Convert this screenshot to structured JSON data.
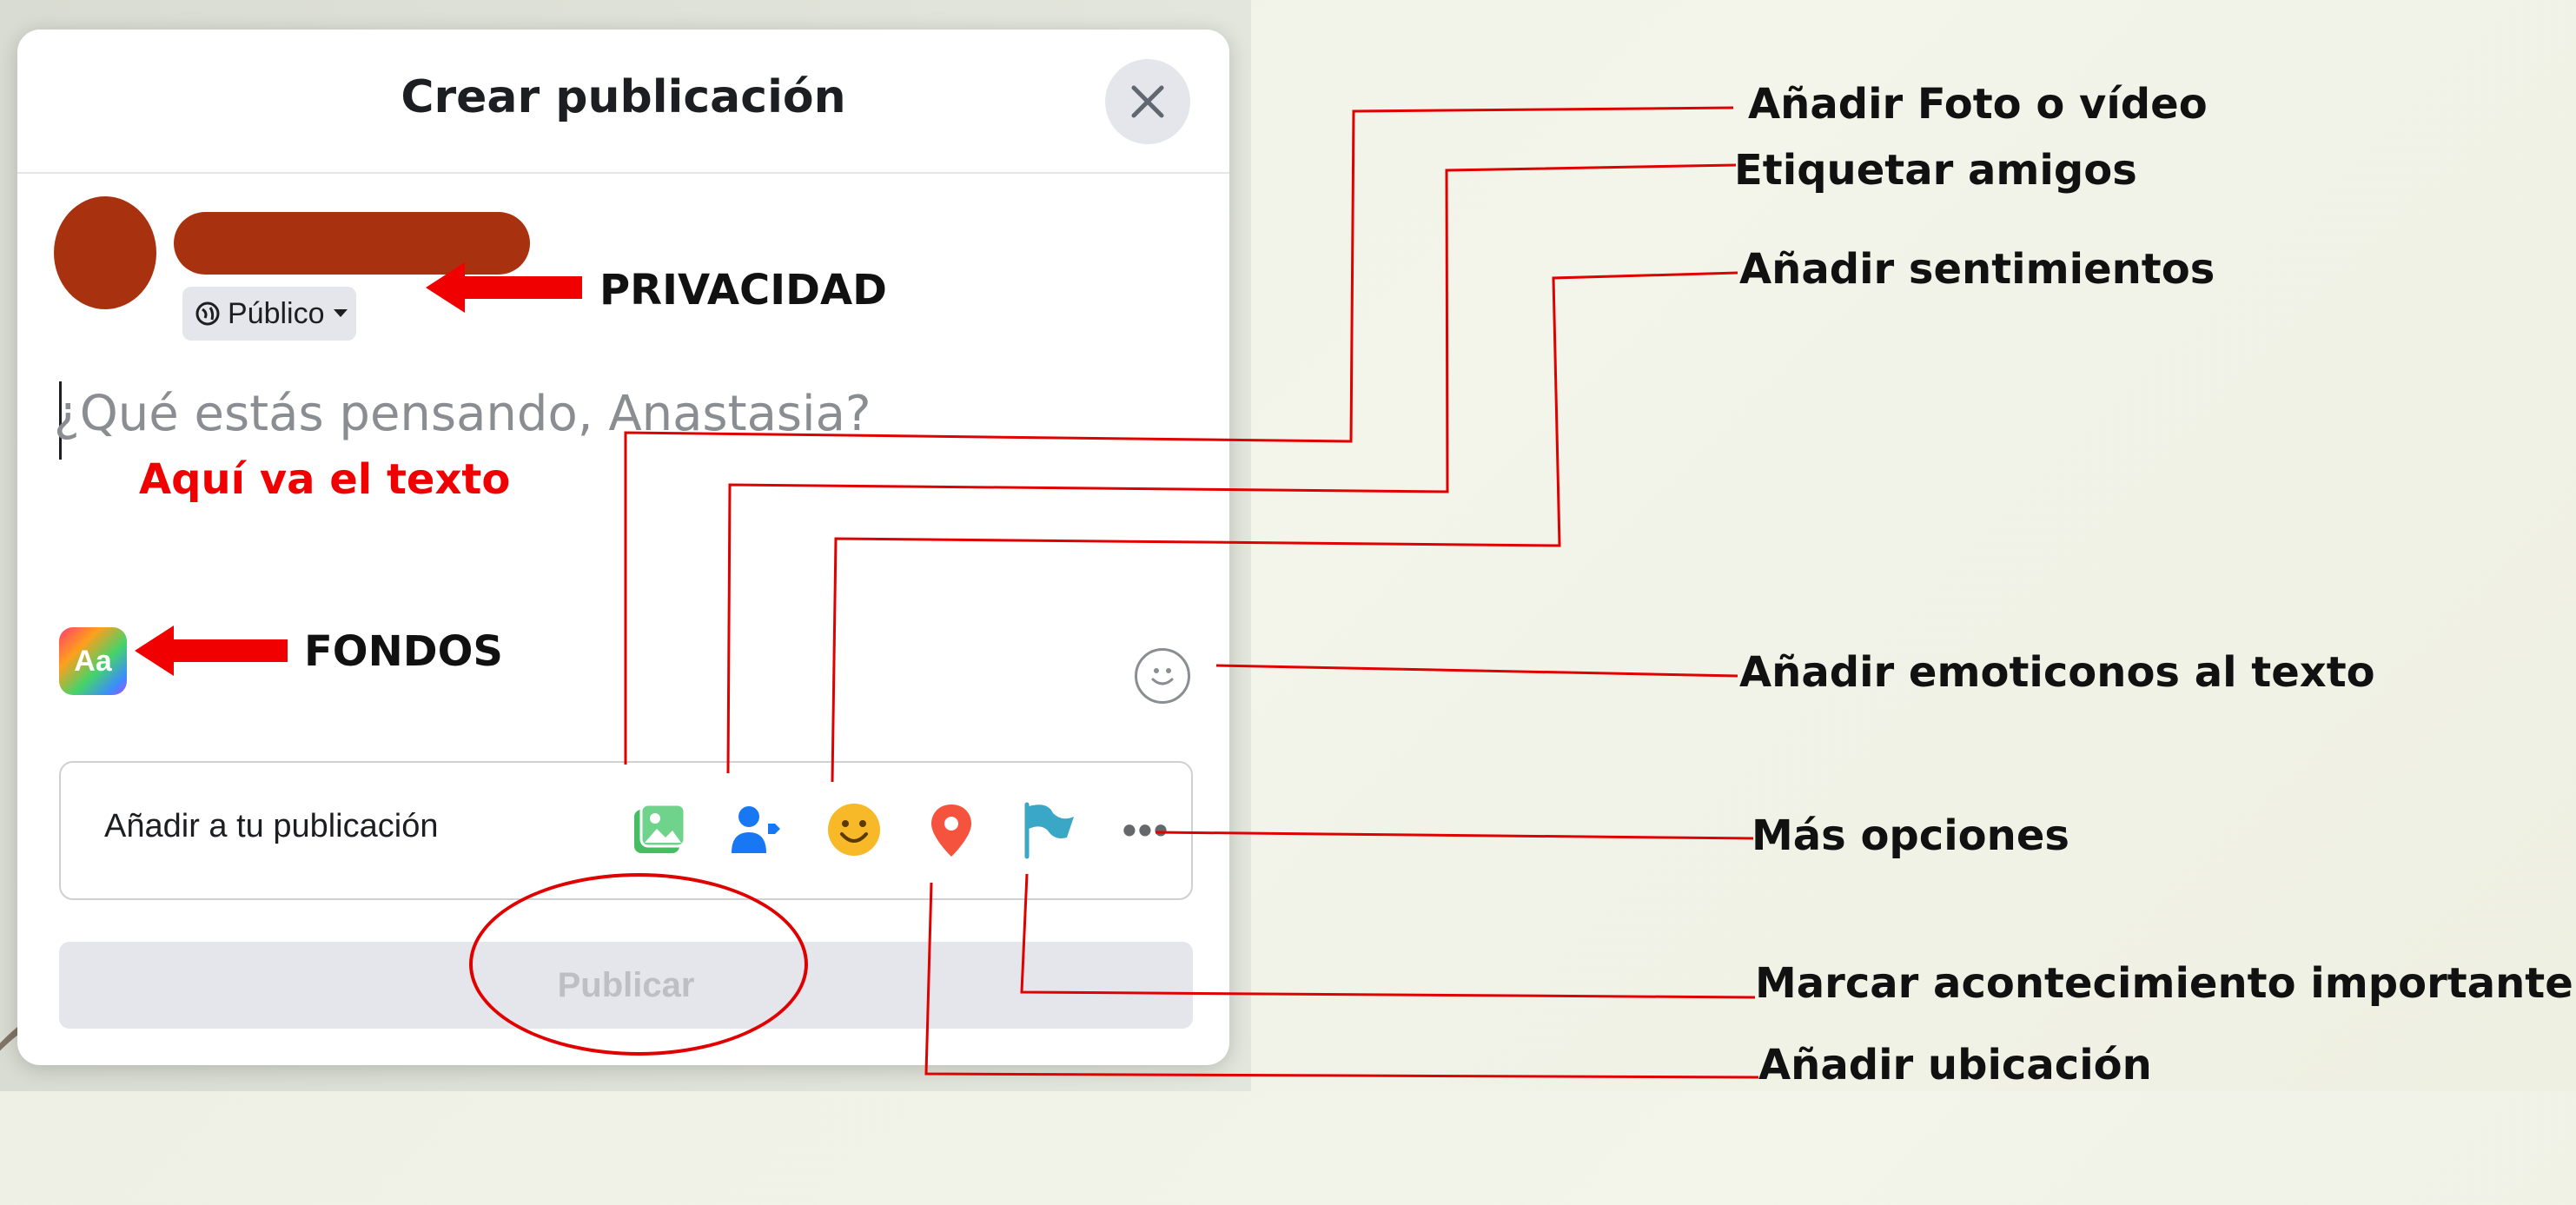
{
  "dialog": {
    "title": "Crear publicación",
    "privacy_label": "Público",
    "composer_placeholder": "¿Qué estás pensando, Anastasia?",
    "add_to_post_label": "Añadir a tu publicación",
    "publish_label": "Publicar",
    "background_button_label": "Aa",
    "toolbar_icons": [
      "photo-video-icon",
      "tag-friends-icon",
      "feeling-icon",
      "location-icon",
      "life-event-flag-icon",
      "more-options-icon"
    ]
  },
  "annotations": {
    "privacy": "PRIVACIDAD",
    "text_here": "Aquí va el texto",
    "backgrounds": "FONDOS",
    "add_photo": "Añadir Foto o vídeo",
    "tag_friends": "Etiquetar amigos",
    "add_feelings": "Añadir sentimientos",
    "add_emoji": "Añadir emoticonos al texto",
    "more_options": "Más opciones",
    "life_event": "Marcar acontecimiento importante",
    "add_location": "Añadir ubicación"
  },
  "colors": {
    "annotation_red": "#f00000",
    "redacted": "#a8320f",
    "dialog_bg": "#ffffff"
  }
}
